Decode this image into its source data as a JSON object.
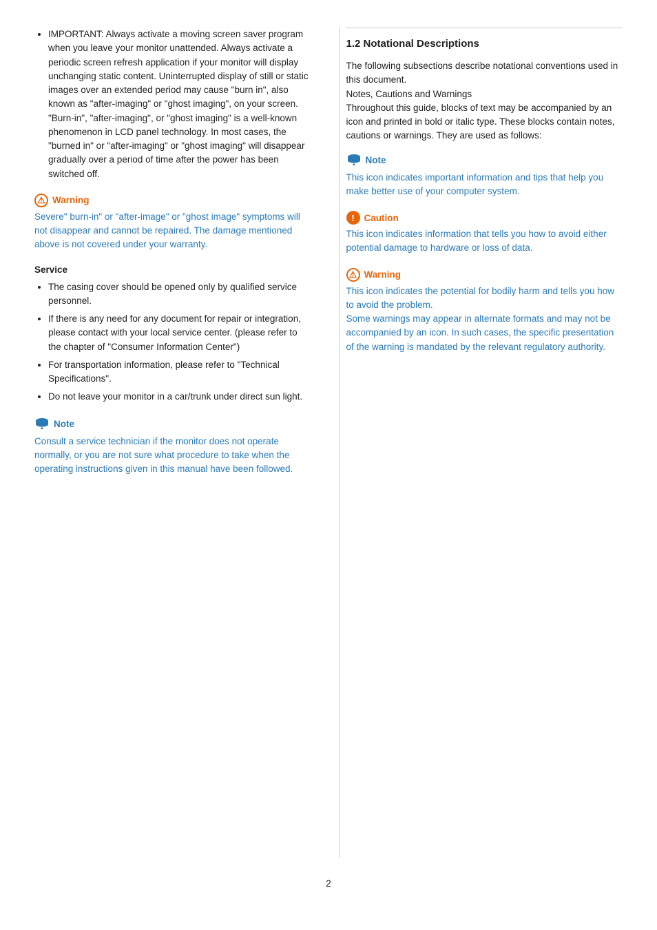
{
  "left": {
    "bullet_intro": "IMPORTANT: Always activate a moving screen saver program when you leave your monitor unattended. Always activate a periodic screen refresh application if your monitor will display unchanging static content. Uninterrupted display of still or static images over an extended period may cause \"burn in\", also known as \"after-imaging\" or \"ghost imaging\", on your screen. \"Burn-in\", \"after-imaging\", or \"ghost imaging\" is a well-known phenomenon in LCD panel technology. In most cases, the \"burned in\" or \"after-imaging\" or \"ghost imaging\" will disappear gradually over a period of time after the power has been switched off.",
    "warning1": {
      "label": "Warning",
      "text": "Severe\" burn-in\" or \"after-image\" or \"ghost image\" symptoms will not disappear and cannot be repaired. The damage mentioned above is not covered under your warranty."
    },
    "service_title": "Service",
    "service_items": [
      "The casing cover should be opened only by qualified service personnel.",
      "If there is any need for any document for repair or integration, please contact with your local service center. (please refer to the chapter of \"Consumer Information Center\")",
      "For transportation information, please refer to \"Technical Specifications\".",
      "Do not leave your monitor in a car/trunk under direct sun light."
    ],
    "note1": {
      "label": "Note",
      "text": "Consult a service technician if the monitor does not operate normally, or you are not sure what procedure to take when the operating instructions given in this manual have been followed."
    }
  },
  "right": {
    "section_title": "1.2 Notational Descriptions",
    "intro_text": "The following subsections describe notational conventions used in this document.\nNotes, Cautions and Warnings\nThroughout this guide, blocks of text may be accompanied by an icon and printed in bold or italic type. These blocks contain notes, cautions or warnings. They are used as follows:",
    "note": {
      "label": "Note",
      "text": "This icon indicates important information and tips that help you make better use of your computer system."
    },
    "caution": {
      "label": "Caution",
      "text": "This icon indicates information that tells you how to avoid either potential damage to hardware or loss of data."
    },
    "warning": {
      "label": "Warning",
      "text": "This icon indicates the potential for bodily harm and tells you how to avoid the problem.\nSome warnings may appear in alternate formats and may not be accompanied by an icon. In such cases, the specific presentation of the warning is mandated by the relevant regulatory authority."
    }
  },
  "page_number": "2"
}
